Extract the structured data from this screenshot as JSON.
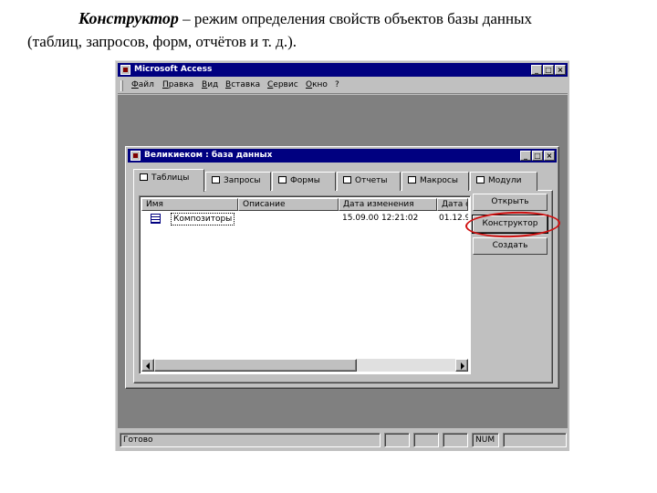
{
  "caption": {
    "term": "Конструктор",
    "line1_rest": " – режим определения свойств объектов базы данных",
    "line2": "(таблиц, запросов, форм, отчётов и т. д.)."
  },
  "app": {
    "title": "Microsoft Access",
    "window_buttons": {
      "minimize": "_",
      "maximize": "□",
      "close": "×"
    }
  },
  "menu": [
    "Файл",
    "Правка",
    "Вид",
    "Вставка",
    "Сервис",
    "Окно",
    "?"
  ],
  "db_window": {
    "title": "Великиеком : база данных",
    "tabs": [
      {
        "label": "Таблицы",
        "icon": "table-icon",
        "active": true
      },
      {
        "label": "Запросы",
        "icon": "query-icon"
      },
      {
        "label": "Формы",
        "icon": "form-icon"
      },
      {
        "label": "Отчеты",
        "icon": "report-icon"
      },
      {
        "label": "Макросы",
        "icon": "macro-icon"
      },
      {
        "label": "Модули",
        "icon": "module-icon"
      }
    ],
    "columns": [
      "Имя",
      "Описание",
      "Дата изменения",
      "Дата со"
    ],
    "rows": [
      {
        "name": "Композиторы",
        "description": "",
        "modified": "15.09.00 12:21:02",
        "created": "01.12.9"
      }
    ],
    "buttons": {
      "open": "Открыть",
      "design": "Конструктор",
      "create": "Создать"
    }
  },
  "status": {
    "text": "Готово",
    "num": "NUM"
  },
  "colors": {
    "titlebar": "#000080",
    "face": "#c0c0c0",
    "highlight_ring": "#d01010"
  }
}
